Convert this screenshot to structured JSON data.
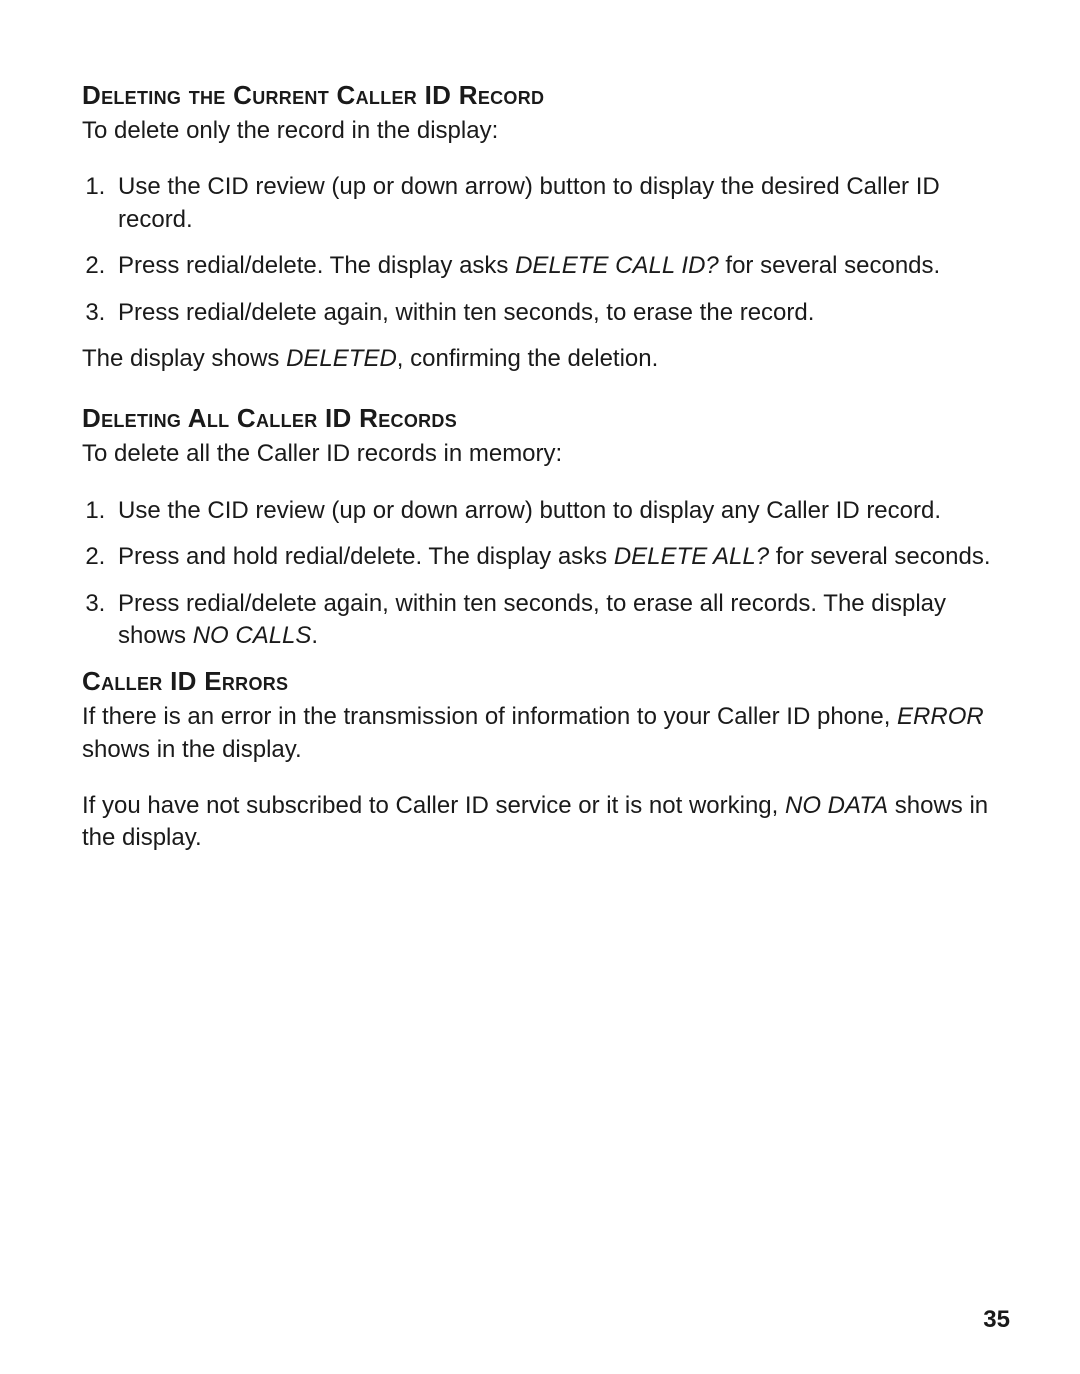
{
  "page_number": "35",
  "sections": [
    {
      "heading": "Deleting the Current Caller ID Record",
      "intro": "To delete only the record in the display:",
      "steps": [
        [
          {
            "t": "Use the CID review (up or down arrow) button to display the desired Caller ID record."
          }
        ],
        [
          {
            "t": "Press redial/delete. The display asks "
          },
          {
            "t": "DELETE CALL ID?",
            "i": true
          },
          {
            "t": " for several seconds."
          }
        ],
        [
          {
            "t": "Press redial/delete again, within ten seconds, to erase the record."
          }
        ]
      ],
      "after": [
        [
          {
            "t": "The display shows "
          },
          {
            "t": "DELETED",
            "i": true
          },
          {
            "t": ", confirming the deletion."
          }
        ]
      ]
    },
    {
      "heading": "Deleting All Caller ID Records",
      "intro": "To delete all the Caller ID records in memory:",
      "steps": [
        [
          {
            "t": "Use the CID review (up or down arrow) button to display any Caller ID record."
          }
        ],
        [
          {
            "t": "Press and hold redial/delete. The display asks "
          },
          {
            "t": "DELETE ALL?",
            "i": true
          },
          {
            "t": " for several seconds."
          }
        ],
        [
          {
            "t": "Press redial/delete again, within ten seconds, to erase all records. The display shows "
          },
          {
            "t": "NO CALLS",
            "i": true
          },
          {
            "t": "."
          }
        ]
      ],
      "after": []
    },
    {
      "heading": "Caller ID Errors",
      "intro": "",
      "steps": [],
      "after": [
        [
          {
            "t": "If there is an error in the transmission of information to your Caller ID phone, "
          },
          {
            "t": "ERROR",
            "i": true
          },
          {
            "t": " shows in the display."
          }
        ],
        [
          {
            "t": "If you have not subscribed to Caller ID service or it is not working, "
          },
          {
            "t": "NO DATA",
            "i": true
          },
          {
            "t": " shows in the display."
          }
        ]
      ]
    }
  ]
}
